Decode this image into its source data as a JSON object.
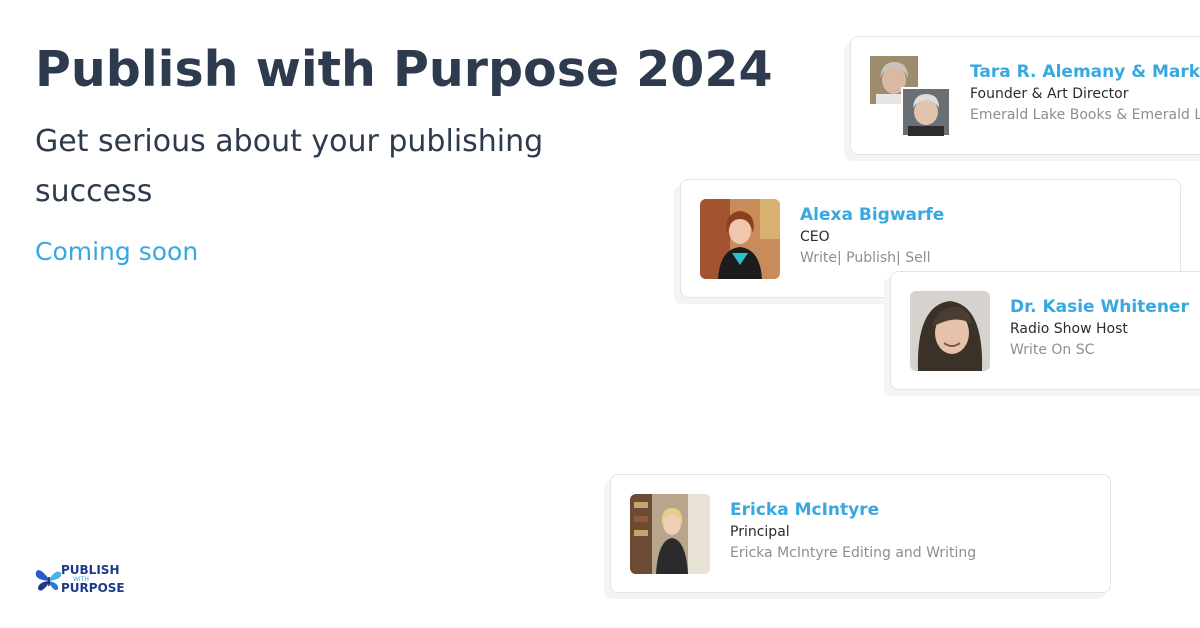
{
  "hero": {
    "title": "Publish with Purpose 2024",
    "subtitle": "Get serious about your publishing success",
    "status": "Coming soon"
  },
  "speakers": [
    {
      "name": "Tara R. Alemany & Mark Gerber",
      "role": "Founder & Art Director",
      "org": "Emerald Lake Books & Emerald Lake Design"
    },
    {
      "name": "Alexa Bigwarfe",
      "role": "CEO",
      "org": "Write| Publish| Sell"
    },
    {
      "name": "Dr. Kasie Whitener",
      "role": "Radio Show Host",
      "org": "Write On SC"
    },
    {
      "name": "Ericka McIntyre",
      "role": "Principal",
      "org": "Ericka McIntyre Editing and Writing"
    }
  ],
  "logo": {
    "line1": "PUBLISH",
    "line2": "WITH",
    "line3": "PURPOSE",
    "icon": "butterfly-icon"
  },
  "colors": {
    "heading": "#2e3a4d",
    "accent": "#38a8e0",
    "brand": "#1b3b8a"
  }
}
